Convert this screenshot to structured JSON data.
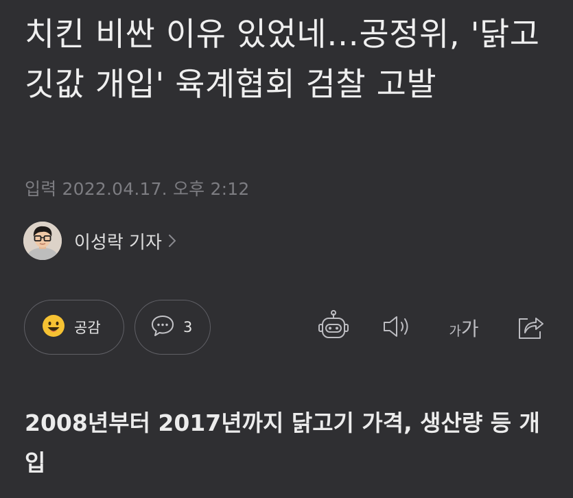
{
  "article": {
    "headline": "치킨 비싼 이유 있었네…공정위, '닭고깃값 개입' 육계협회 검찰 고발",
    "date": "입력 2022.04.17. 오후 2:12",
    "author": "이성락 기자",
    "subtitle": "2008년부터 2017년까지 닭고기 가격, 생산량 등 개입"
  },
  "actions": {
    "like_label": "공감",
    "comment_count": "3",
    "font_small": "가",
    "font_large": "가"
  },
  "icons": {
    "like": "smile-emoji-icon",
    "comment": "speech-bubble-icon",
    "bot": "robot-icon",
    "speaker": "speaker-icon",
    "font": "font-size-icon",
    "share": "share-icon",
    "chevron": "chevron-right-icon"
  },
  "colors": {
    "background": "#2f2f32",
    "text": "#ececec",
    "muted": "#7d7d82",
    "emoji": "#f6c233",
    "border": "#606066"
  }
}
